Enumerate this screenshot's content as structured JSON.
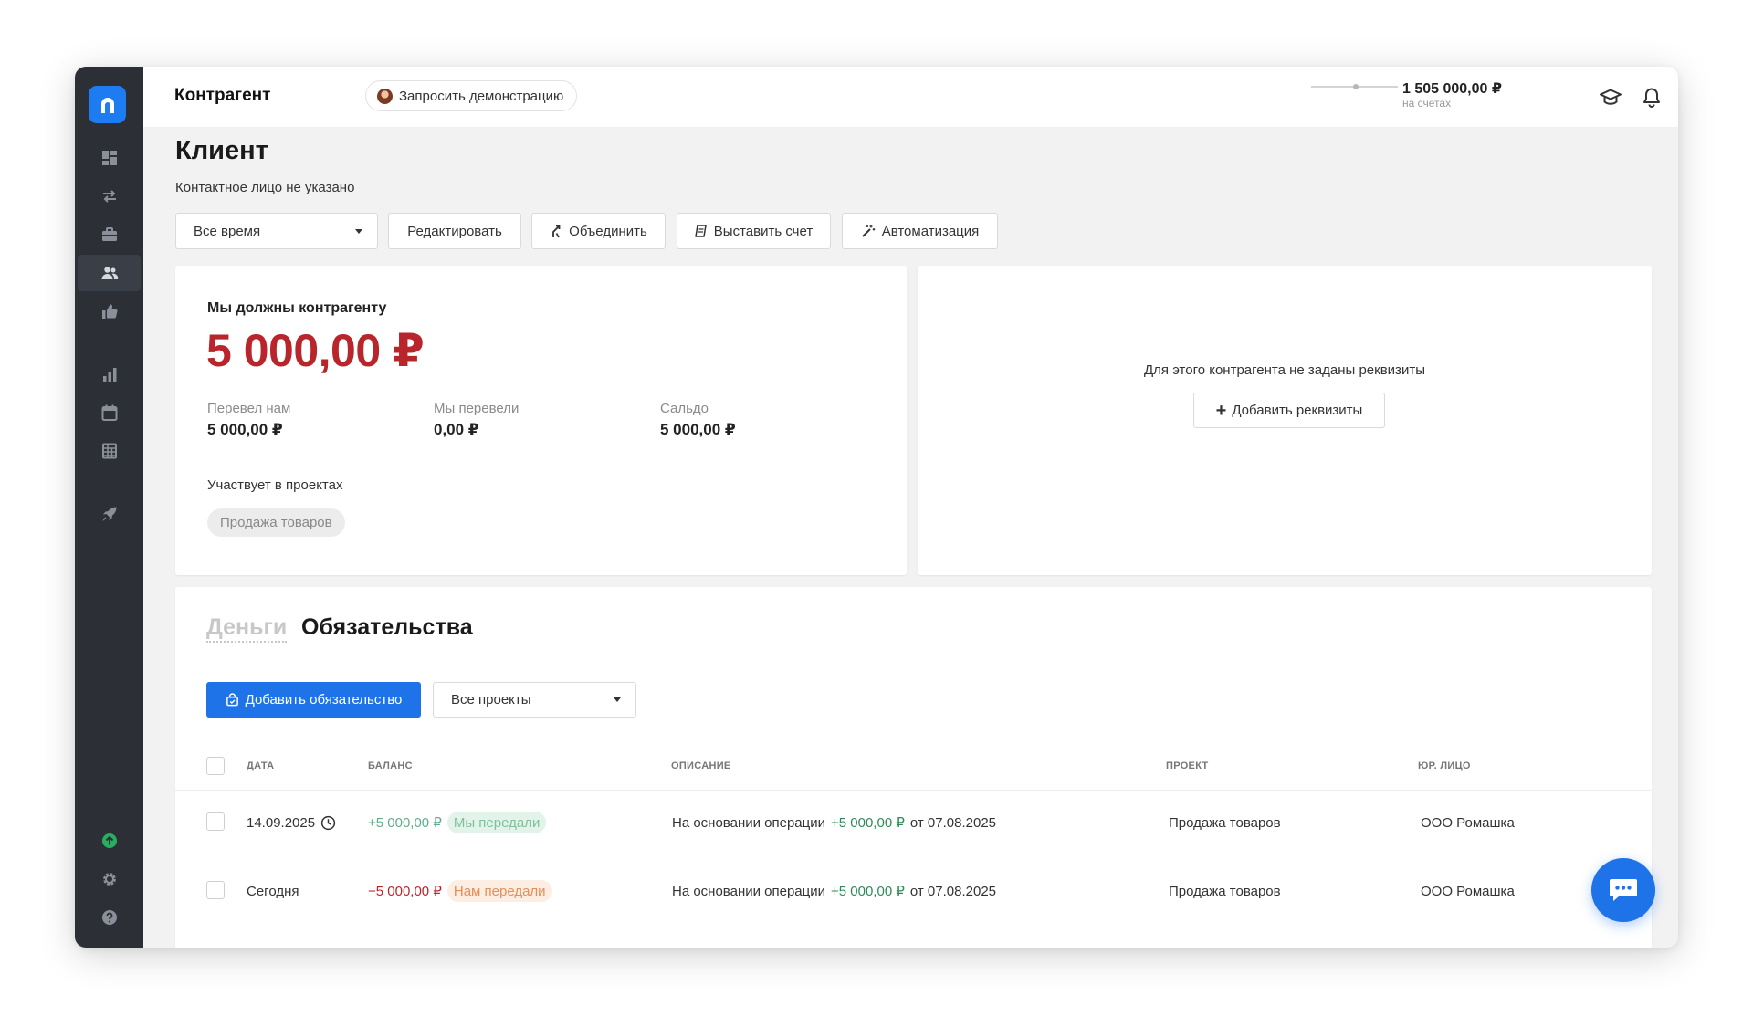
{
  "header": {
    "app_title": "Контрагент",
    "demo_label": "Запросить демонстрацию",
    "balance_amount": "1 505 000,00 ₽",
    "balance_caption": "на счетах"
  },
  "sidebar": {
    "items": [
      {
        "icon": "dashboard-icon"
      },
      {
        "icon": "transfer-icon"
      },
      {
        "icon": "briefcase-icon"
      },
      {
        "icon": "contacts-icon",
        "active": true
      },
      {
        "icon": "thumbs-up-icon"
      },
      {
        "icon": "bar-chart-icon"
      },
      {
        "icon": "calendar-icon"
      },
      {
        "icon": "table-icon"
      },
      {
        "icon": "rocket-icon"
      }
    ],
    "bottom": [
      {
        "icon": "upload-circle-icon",
        "color": "#27ae60"
      },
      {
        "icon": "gear-icon"
      },
      {
        "icon": "help-icon"
      }
    ]
  },
  "page": {
    "title": "Клиент",
    "subtitle": "Контактное лицо не указано"
  },
  "toolbar": {
    "period_select": "Все время",
    "edit_label": "Редактировать",
    "merge_label": "Объединить",
    "invoice_label": "Выставить счет",
    "automation_label": "Автоматизация"
  },
  "summary": {
    "owe_label": "Мы должны контрагенту",
    "owe_amount": "5 000,00 ₽",
    "stats": [
      {
        "label": "Перевел нам",
        "value": "5 000,00 ₽"
      },
      {
        "label": "Мы перевели",
        "value": "0,00 ₽"
      },
      {
        "label": "Сальдо",
        "value": "5 000,00 ₽"
      }
    ],
    "projects_label": "Участвует в проектах",
    "projects": [
      "Продажа товаров"
    ]
  },
  "requisites": {
    "empty_text": "Для этого контрагента не заданы реквизиты",
    "add_label": "Добавить реквизиты"
  },
  "tabs": {
    "money": "Деньги",
    "obligations": "Обязательства"
  },
  "obligations": {
    "add_label": "Добавить обязательство",
    "project_filter": "Все проекты",
    "columns": [
      "ДАТА",
      "БАЛАНС",
      "ОПИСАНИЕ",
      "ПРОЕКТ",
      "ЮР. ЛИЦО"
    ],
    "rows": [
      {
        "date": "14.09.2025",
        "has_clock": true,
        "balance": "+5 000,00 ₽",
        "badge": "Мы передали",
        "desc_prefix": "На основании операции",
        "desc_amount": "+5 000,00 ₽",
        "desc_suffix": "от 07.08.2025",
        "project": "Продажа товаров",
        "entity": "ООО Ромашка"
      },
      {
        "date": "Сегодня",
        "has_clock": false,
        "balance": "−5 000,00 ₽",
        "badge": "Нам передали",
        "desc_prefix": "На основании операции",
        "desc_amount": "+5 000,00 ₽",
        "desc_suffix": "от 07.08.2025",
        "project": "Продажа товаров",
        "entity": "ООО Ромашка"
      }
    ]
  },
  "colors": {
    "accent": "#1e73e8",
    "sidebar": "#2c2f36",
    "debt": "#b8262c",
    "positive": "#2e8b57"
  }
}
